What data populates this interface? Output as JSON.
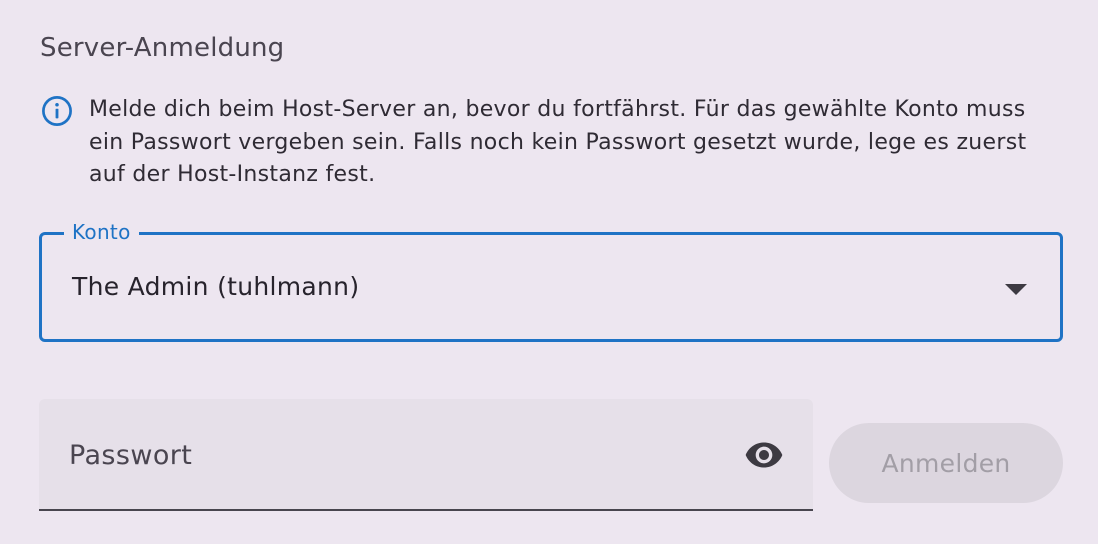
{
  "section": {
    "title": "Server-Anmeldung"
  },
  "info": {
    "icon": "info-icon",
    "text": "Melde dich beim Host-Server an, bevor du fortfährst. Für das gewählte Konto muss ein Passwort vergeben sein. Falls noch kein Passwort gesetzt wurde, lege es zuerst auf der Host-Instanz fest.",
    "icon_color": "#1f73c5"
  },
  "account_select": {
    "label": "Konto",
    "value": "The Admin (tuhlmann)",
    "icon": "dropdown-arrow-icon",
    "accent_color": "#1f73c5"
  },
  "password": {
    "placeholder": "Passwort",
    "value": "",
    "toggle_icon": "eye-icon"
  },
  "login_button": {
    "label": "Anmelden",
    "enabled": false
  },
  "colors": {
    "background": "#ede6f0",
    "field_fill": "#e6e0e9",
    "button_disabled_bg": "#dcd6df",
    "button_disabled_text": "#a29ea6"
  }
}
